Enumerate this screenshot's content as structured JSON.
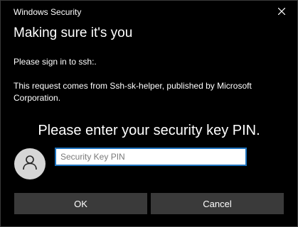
{
  "window": {
    "title": "Windows Security",
    "close_icon": "close-icon"
  },
  "dialog": {
    "heading": "Making sure it's you",
    "signin_text": "Please sign in to ssh:.",
    "request_text": "This request comes from Ssh-sk-helper, published by Microsoft Corporation.",
    "pin_prompt": "Please enter your security key PIN.",
    "avatar_icon": "user-icon"
  },
  "pin_field": {
    "placeholder": "Security Key PIN",
    "value": ""
  },
  "buttons": {
    "ok_label": "OK",
    "cancel_label": "Cancel"
  },
  "colors": {
    "background": "#000000",
    "input_border": "#1e73be",
    "button_bg": "#3a3a3a",
    "avatar_bg": "#d6d6d6"
  }
}
